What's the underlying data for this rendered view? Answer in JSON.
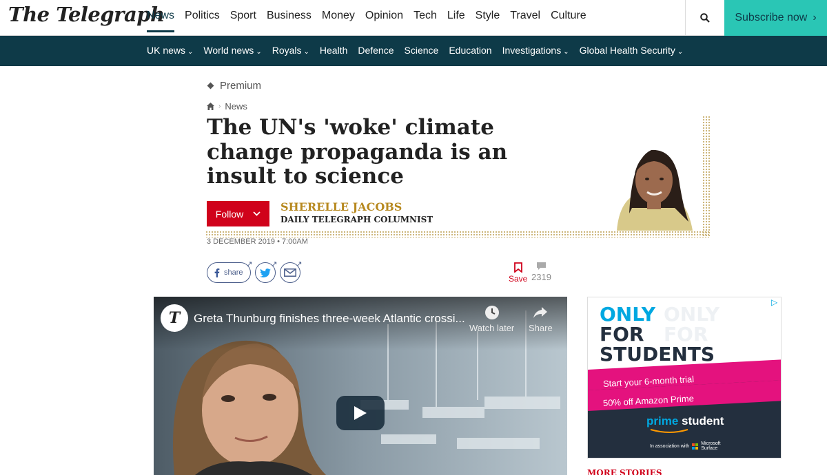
{
  "brand": {
    "logo": "The Telegraph",
    "accent": "#2ac6b5",
    "dark": "#0e3a48",
    "red": "#d0021b"
  },
  "main_nav": [
    {
      "label": "News",
      "active": true
    },
    {
      "label": "Politics"
    },
    {
      "label": "Sport"
    },
    {
      "label": "Business"
    },
    {
      "label": "Money"
    },
    {
      "label": "Opinion"
    },
    {
      "label": "Tech"
    },
    {
      "label": "Life"
    },
    {
      "label": "Style"
    },
    {
      "label": "Travel"
    },
    {
      "label": "Culture"
    }
  ],
  "subscribe_label": "Subscribe now",
  "sub_nav": [
    {
      "label": "UK news",
      "caret": true
    },
    {
      "label": "World news",
      "caret": true
    },
    {
      "label": "Royals",
      "caret": true
    },
    {
      "label": "Health",
      "caret": false
    },
    {
      "label": "Defence",
      "caret": false
    },
    {
      "label": "Science",
      "caret": false
    },
    {
      "label": "Education",
      "caret": false
    },
    {
      "label": "Investigations",
      "caret": true
    },
    {
      "label": "Global Health Security",
      "caret": true
    }
  ],
  "article": {
    "premium": "Premium",
    "breadcrumb": "News",
    "headline": "The UN's 'woke' climate change propaganda is an insult to science",
    "follow": "Follow",
    "author_name": "SHERELLE JACOBS",
    "author_role": "DAILY TELEGRAPH COLUMNIST",
    "date": "3 DECEMBER 2019 • 7:00AM",
    "share_label": "share",
    "save_label": "Save",
    "comment_count": "2319"
  },
  "video": {
    "title": "Greta Thunburg finishes three-week Atlantic crossi...",
    "watch_later": "Watch later",
    "share": "Share"
  },
  "ad": {
    "line1": "ONLY",
    "line2": "FOR",
    "line3": "STUDENTS",
    "offer1": "Start your 6-month trial",
    "offer2": "50% off Amazon Prime",
    "prime": "prime",
    "student": "student",
    "association": "In association with",
    "partner": "Microsoft Surface"
  },
  "more_stories": "MORE STORIES"
}
